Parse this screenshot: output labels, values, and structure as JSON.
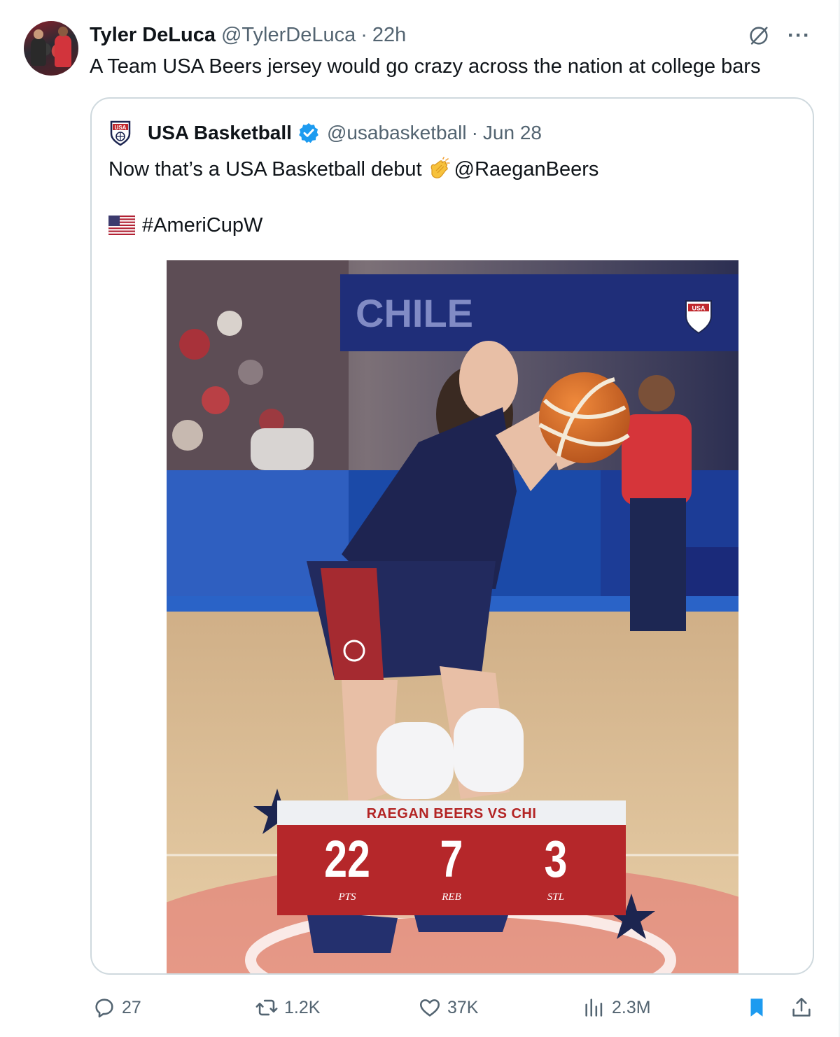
{
  "tweet": {
    "author_name": "Tyler DeLuca",
    "author_handle": "@TylerDeLuca",
    "separator": "·",
    "time": "22h",
    "text": "A Team USA Beers jersey would go crazy across the nation at college bars",
    "more_label": "···"
  },
  "quoted": {
    "author_name": "USA Basketball",
    "author_handle": "@usabasketball",
    "separator": "·",
    "date": "Jun 28",
    "text_before": "Now that’s a USA Basketball debut",
    "mention": "@RaeganBeers",
    "hashtag": "#AmeriCupW",
    "image": {
      "arena_sign": "CHILE",
      "logo_text": "USA",
      "card_title": "RAEGAN BEERS VS CHI",
      "stats": [
        {
          "value": "22",
          "label": "PTS"
        },
        {
          "value": "7",
          "label": "REB"
        },
        {
          "value": "3",
          "label": "STL"
        }
      ]
    }
  },
  "actions": {
    "replies": "27",
    "reposts": "1.2K",
    "likes": "37K",
    "views": "2.3M"
  },
  "colors": {
    "text": "#0f1419",
    "secondary": "#536471",
    "border": "#cfd9de",
    "verified": "#1d9bf0",
    "bookmark": "#1d9bf0",
    "stat_red": "#b5272a",
    "navy": "#1c2550"
  },
  "icons": [
    "grok-icon",
    "more-icon",
    "verified-icon",
    "clap-icon",
    "flag-icon",
    "reply-icon",
    "repost-icon",
    "like-icon",
    "views-icon",
    "bookmark-icon",
    "share-icon"
  ]
}
